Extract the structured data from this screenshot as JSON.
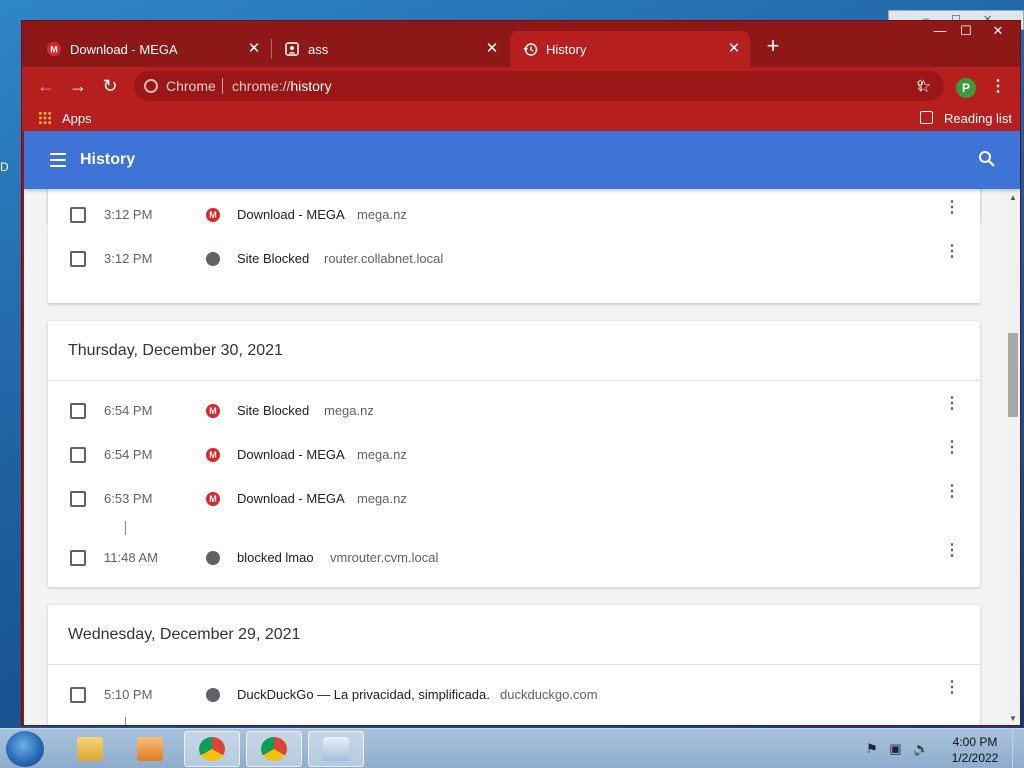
{
  "desktop": {
    "edge_label": "D"
  },
  "tabs": [
    {
      "label": "Download - MEGA",
      "icon": "mega-icon"
    },
    {
      "label": "ass",
      "icon": "account-box-icon"
    },
    {
      "label": "History",
      "icon": "history-icon"
    }
  ],
  "window_controls": {
    "minimize": "—",
    "maximize": "☐",
    "close": "✕"
  },
  "omnibox": {
    "scheme": "Chrome",
    "url_prefix": "chrome://",
    "url_path": "history"
  },
  "profile_initial": "P",
  "bookmarks_bar": {
    "apps_label": "Apps",
    "reading_list_label": "Reading list"
  },
  "history_header": {
    "title": "History"
  },
  "entries_top": [
    {
      "time": "3:12 PM",
      "icon": "mega",
      "title": "Download - MEGA",
      "domain": "mega.nz"
    },
    {
      "time": "3:12 PM",
      "icon": "globe",
      "title": "Site Blocked",
      "domain": "router.collabnet.local"
    }
  ],
  "day_thursday": {
    "heading": "Thursday, December 30, 2021",
    "entries": [
      {
        "time": "6:54 PM",
        "icon": "mega",
        "title": "Site Blocked",
        "domain": "mega.nz"
      },
      {
        "time": "6:54 PM",
        "icon": "mega",
        "title": "Download - MEGA",
        "domain": "mega.nz"
      },
      {
        "time": "6:53 PM",
        "icon": "mega",
        "title": "Download - MEGA",
        "domain": "mega.nz"
      },
      {
        "time": "11:48 AM",
        "icon": "globe",
        "title": "blocked lmao",
        "domain": "vmrouter.cvm.local"
      }
    ]
  },
  "day_wednesday": {
    "heading": "Wednesday, December 29, 2021",
    "entries": [
      {
        "time": "5:10 PM",
        "icon": "globe",
        "title": "DuckDuckGo — La privacidad, simplificada.",
        "domain": "duckduckgo.com"
      }
    ]
  },
  "taskbar": {
    "clock_time": "4:00 PM",
    "clock_date": "1/2/2022",
    "apps": [
      "windows-explorer",
      "media-player",
      "chrome",
      "chrome-profile-p",
      "notepad"
    ]
  },
  "colors": {
    "chrome_frame": "#8e1717",
    "active_tab": "#b71e1e",
    "history_bar": "#3e74d6",
    "mega_red": "#d9272e"
  }
}
